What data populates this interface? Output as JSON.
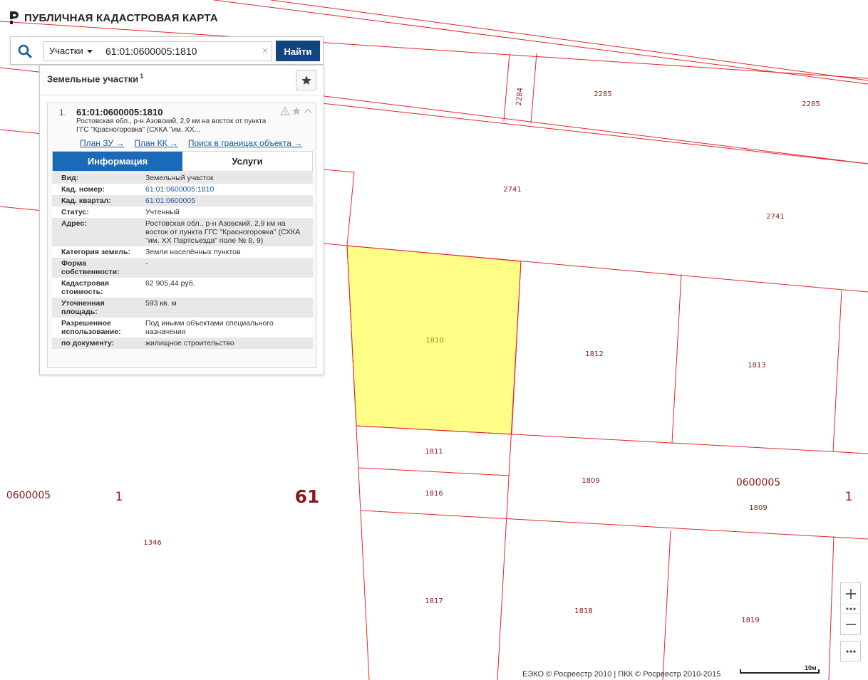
{
  "app": {
    "title": "ПУБЛИЧНАЯ КАДАСТРОВАЯ КАРТА"
  },
  "search": {
    "type_label": "Участки",
    "query": "61:01:0600005:1810",
    "clear_symbol": "×",
    "find_label": "Найти"
  },
  "results": {
    "title": "Земельные участки",
    "count": "1",
    "item": {
      "number": "1.",
      "cad_number": "61:01:0600005:1810",
      "address_short": "Ростовская обл., р-н Азовский, 2,9 км на восток от пункта ГГС \"Красногоровка\" (СХКА \"им. XX...",
      "links": [
        "План ЗУ →",
        "План КК →",
        "Поиск в границах объекта →"
      ],
      "tabs": [
        "Информация",
        "Услуги"
      ],
      "info": [
        {
          "k": "Вид:",
          "v": "Земельный участок"
        },
        {
          "k": "Кад. номер:",
          "v": "61:01:0600005:1810"
        },
        {
          "k": "Кад. квартал:",
          "v": "61:01:0600005"
        },
        {
          "k": "Статус:",
          "v": "Учтенный"
        },
        {
          "k": "Адрес:",
          "v": "Ростовская обл., р-н Азовский, 2,9 км на восток от пункта ГГС \"Красногоровка\" (СХКА \"им. XX Партсъезда\" поле № 8, 9)"
        },
        {
          "k": "Категория земель:",
          "v": "Земли населённых пунктов"
        },
        {
          "k": "Форма собственности:",
          "v": "-"
        },
        {
          "k": "Кадастровая стоимость:",
          "v": "62 905,44 руб."
        },
        {
          "k": "Уточненная площадь:",
          "v": "593 кв. м"
        },
        {
          "k": "Разрешенное использование:",
          "v": "Под иными объектами специального назначения"
        },
        {
          "k": "по документу:",
          "v": "жилищное строительство"
        }
      ]
    }
  },
  "map": {
    "parcel_labels": [
      "2284",
      "2285",
      "2285",
      "2741",
      "2741",
      "1810",
      "1812",
      "1813",
      "1811",
      "1816",
      "1809",
      "1809",
      "1346",
      "1817",
      "1818",
      "1819"
    ],
    "quarter_labels": [
      "0600005",
      "1",
      "61",
      "0600005",
      "1"
    ],
    "colors": {
      "boundary": "#e8232a",
      "highlight_fill": "#ffff88",
      "label": "#8b1a1a"
    }
  },
  "controls": {
    "zoom_in": "+",
    "zoom_out": "−"
  },
  "footer": {
    "attribution": "ЕЭКО © Росреестр 2010 | ПКК © Росреестр 2010-2015",
    "scale_label": "10м"
  }
}
